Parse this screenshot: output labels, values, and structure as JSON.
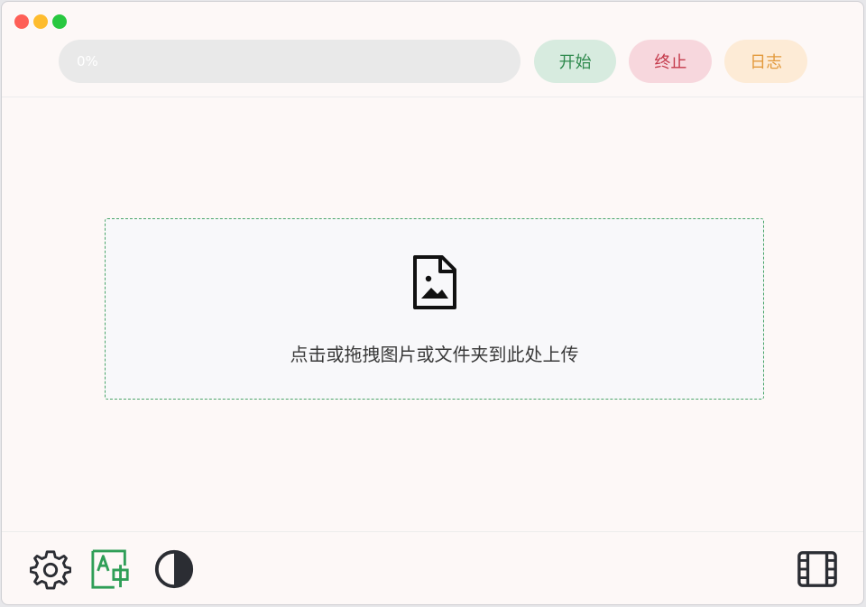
{
  "window": {
    "controls": [
      "close",
      "minimize",
      "maximize"
    ]
  },
  "toolbar": {
    "progress_text": "0%",
    "progress_value": 0,
    "start_label": "开始",
    "stop_label": "终止",
    "log_label": "日志"
  },
  "dropzone": {
    "icon": "image-file-icon",
    "text": "点击或拖拽图片或文件夹到此处上传"
  },
  "footer": {
    "left_icons": [
      "gear-icon",
      "translate-icon",
      "contrast-icon"
    ],
    "right_icons": [
      "film-icon"
    ]
  },
  "colors": {
    "accent_green": "#2f8a4e",
    "danger_red": "#c43a4b",
    "warning_orange": "#e39a3d"
  }
}
